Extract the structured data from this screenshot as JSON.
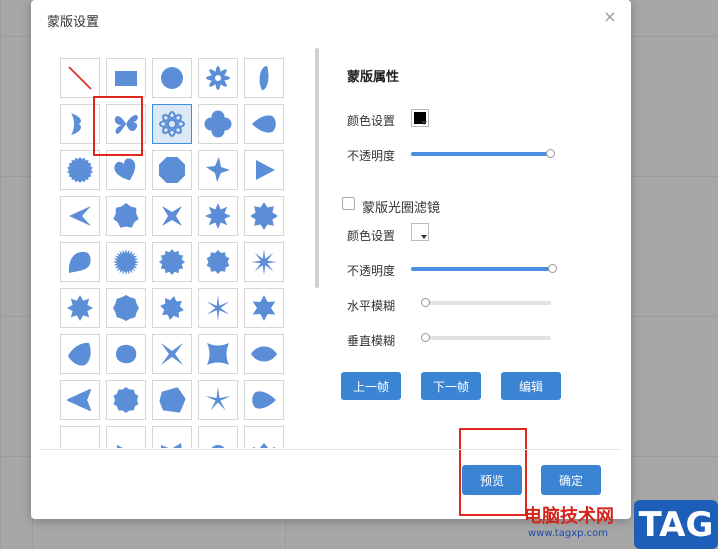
{
  "dialog": {
    "title": "蒙版设置",
    "close_glyph": "×"
  },
  "shapes": {
    "selected_index": 7,
    "fill_color": "#5b8ed6",
    "items": [
      "line",
      "rectangle",
      "circle",
      "asterisk",
      "ellipse-bent",
      "bowtie-half",
      "propeller",
      "flower-rings",
      "clover",
      "teardrop-left",
      "burst-circle",
      "heart",
      "octagon-round",
      "star-4-skew",
      "triangle-right",
      "star-3",
      "heptagon",
      "star-4",
      "star-8",
      "star-8-round",
      "blob-fan",
      "sunburst",
      "star-12",
      "badge-10",
      "star-thin-8",
      "star-8-b",
      "octagon",
      "star-8-c",
      "star-thin-6",
      "star-6",
      "leaf-left",
      "egg",
      "x-cross",
      "square-concave",
      "lens",
      "triangle-left",
      "decagon",
      "rounded-blob",
      "star-thin-4",
      "teardrop-right",
      "half-a",
      "half-b",
      "half-c",
      "half-d",
      "half-e"
    ]
  },
  "panel": {
    "mask_props_title": "蒙版属性",
    "color_label": "颜色设置",
    "color_value": "#000000",
    "opacity_label": "不透明度",
    "opacity_value": 1.0,
    "halo_filter_label": "蒙版光圈滤镜",
    "halo_filter_checked": false,
    "halo_color_label": "颜色设置",
    "halo_color_value": "#ffffff",
    "halo_opacity_label": "不透明度",
    "halo_opacity_value": 1.0,
    "h_blur_label": "水平模糊",
    "h_blur_value": 0.0,
    "v_blur_label": "垂直模糊",
    "v_blur_value": 0.0
  },
  "buttons": {
    "prev_frame": "上一帧",
    "next_frame": "下一帧",
    "edit": "编辑",
    "preview": "预览",
    "confirm": "确定"
  },
  "watermark": {
    "site_name": "电脑技术网",
    "url": "www.tagxp.com",
    "logo": "TAG"
  }
}
